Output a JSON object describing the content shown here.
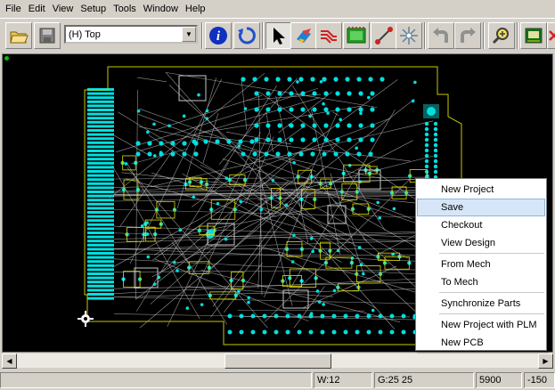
{
  "menubar": {
    "items": [
      {
        "label": "File"
      },
      {
        "label": "Edit"
      },
      {
        "label": "View"
      },
      {
        "label": "Setup"
      },
      {
        "label": "Tools"
      },
      {
        "label": "Window"
      },
      {
        "label": "Help"
      }
    ]
  },
  "toolbar": {
    "layer_value": "(H) Top",
    "buttons": [
      "open-icon",
      "save-icon",
      "info-icon",
      "refresh-icon",
      "select-arrow-icon",
      "component-icon",
      "route-icon",
      "design-verify-icon",
      "trace-icon",
      "ecd-icon",
      "undo-icon",
      "redo-icon",
      "zoom-icon",
      "board-icon",
      "delete-icon"
    ]
  },
  "status": {
    "width": "W:12",
    "grid": "G:25 25",
    "x": "5900",
    "y": "-150"
  },
  "context_menu": {
    "items": [
      {
        "label": "New Project",
        "highlighted": false
      },
      {
        "label": "Save",
        "highlighted": true
      },
      {
        "label": "Checkout",
        "highlighted": false
      },
      {
        "label": "View Design",
        "highlighted": false
      },
      {
        "label": "From Mech",
        "highlighted": false
      },
      {
        "label": "To Mech",
        "highlighted": false
      },
      {
        "label": "Synchronize Parts",
        "highlighted": false
      },
      {
        "label": "New Project with PLM",
        "highlighted": false
      },
      {
        "label": "New PCB",
        "highlighted": false
      }
    ]
  },
  "colors": {
    "pad": "#00e0e0",
    "board_outline": "#c8c800",
    "trace": "#c8c8c8",
    "silk": "#e0e000",
    "canvas": "#000000"
  }
}
